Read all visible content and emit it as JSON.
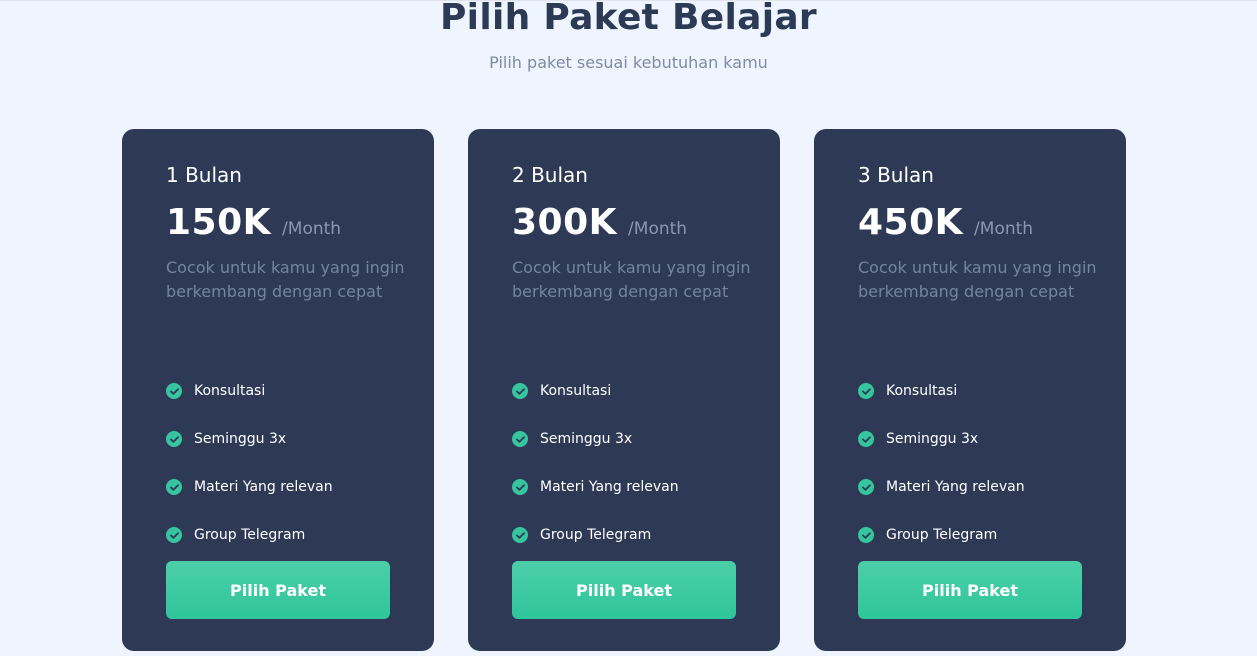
{
  "header": {
    "title": "Pilih Paket Belajar",
    "subtitle": "Pilih paket sesuai kebutuhan kamu"
  },
  "colors": {
    "background": "#eff5fe",
    "card": "#2e3a55",
    "accent": "#36c59e",
    "title": "#2d3a55"
  },
  "plans": [
    {
      "name": "1 Bulan",
      "price": "150K",
      "period": "/Month",
      "description": "Cocok untuk kamu yang ingin berkembang dengan cepat",
      "features": [
        "Konsultasi",
        "Seminggu 3x",
        "Materi Yang relevan",
        "Group Telegram"
      ],
      "button_label": "Pilih Paket"
    },
    {
      "name": "2 Bulan",
      "price": "300K",
      "period": "/Month",
      "description": "Cocok untuk kamu yang ingin berkembang dengan cepat",
      "features": [
        "Konsultasi",
        "Seminggu 3x",
        "Materi Yang relevan",
        "Group Telegram"
      ],
      "button_label": "Pilih Paket"
    },
    {
      "name": "3 Bulan",
      "price": "450K",
      "period": "/Month",
      "description": "Cocok untuk kamu yang ingin berkembang dengan cepat",
      "features": [
        "Konsultasi",
        "Seminggu 3x",
        "Materi Yang relevan",
        "Group Telegram"
      ],
      "button_label": "Pilih Paket"
    }
  ],
  "icons": {
    "feature_check": "check-circle-icon"
  }
}
